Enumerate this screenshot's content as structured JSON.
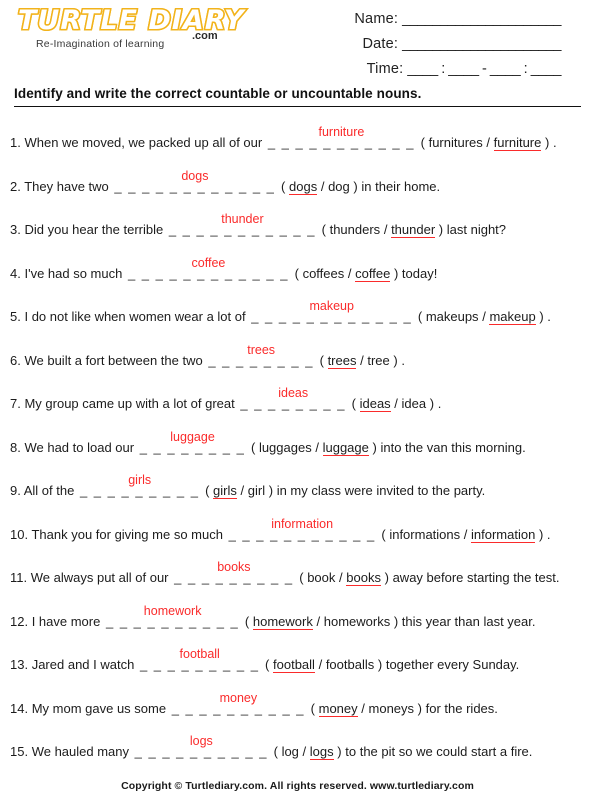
{
  "brand": {
    "logo_wordmark": "TURTLE DIARY",
    "logo_suffix": ".com",
    "tagline": "Re-Imagination of learning",
    "logo_color": "#f2b31b"
  },
  "header": {
    "name_label": "Name:",
    "name_rule": "_____________________",
    "date_label": "Date:",
    "date_rule": "_____________________",
    "time_label": "Time:",
    "time_rule": "____ : ____ - ____ : ____"
  },
  "title": "Identify and write the correct countable or uncountable nouns.",
  "answer_color": "#fa2b2b",
  "questions": [
    {
      "num": "1.",
      "pre": "When we moved, we packed up all of our",
      "dashes": "_ _ _ _ _ _ _ _ _ _ _",
      "answer": "furniture",
      "open": "(",
      "option_a": "furnitures",
      "sep": "/",
      "option_b": "furniture",
      "close": ")",
      "correct": "b",
      "post": "."
    },
    {
      "num": "2.",
      "pre": "They have two",
      "dashes": "_ _ _ _ _ _ _ _ _ _ _ _",
      "answer": "dogs",
      "open": "(",
      "option_a": "dogs",
      "sep": "/",
      "option_b": "dog",
      "close": ")",
      "correct": "a",
      "post": "in their home."
    },
    {
      "num": "3.",
      "pre": "Did you hear the terrible",
      "dashes": "_ _ _ _ _ _ _ _ _ _ _",
      "answer": "thunder",
      "open": "(",
      "option_a": "thunders",
      "sep": "/",
      "option_b": "thunder",
      "close": ")",
      "correct": "b",
      "post": "last night?"
    },
    {
      "num": "4.",
      "pre": "I've had so much",
      "dashes": "_ _ _ _ _ _ _ _ _ _ _ _",
      "answer": "coffee",
      "open": "(",
      "option_a": "coffees",
      "sep": "/",
      "option_b": "coffee",
      "close": ")",
      "correct": "b",
      "post": "today!"
    },
    {
      "num": "5.",
      "pre": "I do not like when women wear a lot of",
      "dashes": "_ _ _ _ _ _ _ _ _ _ _ _",
      "answer": "makeup",
      "open": "(",
      "option_a": "makeups",
      "sep": "/",
      "option_b": "makeup",
      "close": ")",
      "correct": "b",
      "post": "."
    },
    {
      "num": "6.",
      "pre": "We built a fort between the two",
      "dashes": "_ _ _ _ _ _ _ _",
      "answer": "trees",
      "open": "(",
      "option_a": "trees",
      "sep": "/",
      "option_b": "tree",
      "close": ")",
      "correct": "a",
      "post": "."
    },
    {
      "num": "7.",
      "pre": "My group came up with a lot of great",
      "dashes": "_ _ _ _ _ _ _ _",
      "answer": "ideas",
      "open": "(",
      "option_a": "ideas",
      "sep": "/",
      "option_b": "idea",
      "close": ")",
      "correct": "a",
      "post": "."
    },
    {
      "num": "8.",
      "pre": "We had to load our",
      "dashes": "_ _ _ _ _ _ _ _",
      "answer": "luggage",
      "open": "(",
      "option_a": "luggages",
      "sep": "/",
      "option_b": "luggage",
      "close": ")",
      "correct": "b",
      "post": "into the van this morning."
    },
    {
      "num": "9.",
      "pre": "All of the",
      "dashes": "_ _ _ _ _ _ _ _ _",
      "answer": "girls",
      "open": "(",
      "option_a": "girls",
      "sep": "/",
      "option_b": "girl",
      "close": ")",
      "correct": "a",
      "post": "in my class were invited to the party."
    },
    {
      "num": "10.",
      "pre": "Thank you for giving me so much",
      "dashes": "_ _ _ _ _ _ _ _ _ _ _",
      "answer": "information",
      "open": "(",
      "option_a": "informations",
      "sep": "/",
      "option_b": "information",
      "close": ")",
      "correct": "b",
      "post": "."
    },
    {
      "num": "11.",
      "pre": "We always put all of our",
      "dashes": "_ _ _ _ _ _ _ _ _",
      "answer": "books",
      "open": "(",
      "option_a": "book",
      "sep": "/",
      "option_b": "books",
      "close": ")",
      "correct": "b",
      "post": "away before starting the test."
    },
    {
      "num": "12.",
      "pre": "I have more",
      "dashes": "_ _ _ _ _ _ _ _ _ _",
      "answer": "homework",
      "open": "(",
      "option_a": "homework",
      "sep": "/",
      "option_b": "homeworks",
      "close": ")",
      "correct": "a",
      "post": "this year than last year."
    },
    {
      "num": "13.",
      "pre": "Jared and I watch",
      "dashes": "_ _ _ _ _ _ _ _ _",
      "answer": "football",
      "open": "(",
      "option_a": "football",
      "sep": "/",
      "option_b": "footballs",
      "close": ")",
      "correct": "a",
      "post": "together every Sunday."
    },
    {
      "num": "14.",
      "pre": "My mom gave us some",
      "dashes": "_ _ _ _ _ _ _ _ _ _",
      "answer": "money",
      "open": "(",
      "option_a": "money",
      "sep": "/",
      "option_b": "moneys",
      "close": ")",
      "correct": "a",
      "post": "for the rides."
    },
    {
      "num": "15.",
      "pre": "We hauled many",
      "dashes": "_ _ _ _ _ _ _ _ _ _",
      "answer": "logs",
      "open": "(",
      "option_a": "log",
      "sep": "/",
      "option_b": "logs",
      "close": ")",
      "correct": "b",
      "post": "to the pit so we could start a fire."
    }
  ],
  "footer": "Copyright © Turtlediary.com. All rights reserved. www.turtlediary.com"
}
